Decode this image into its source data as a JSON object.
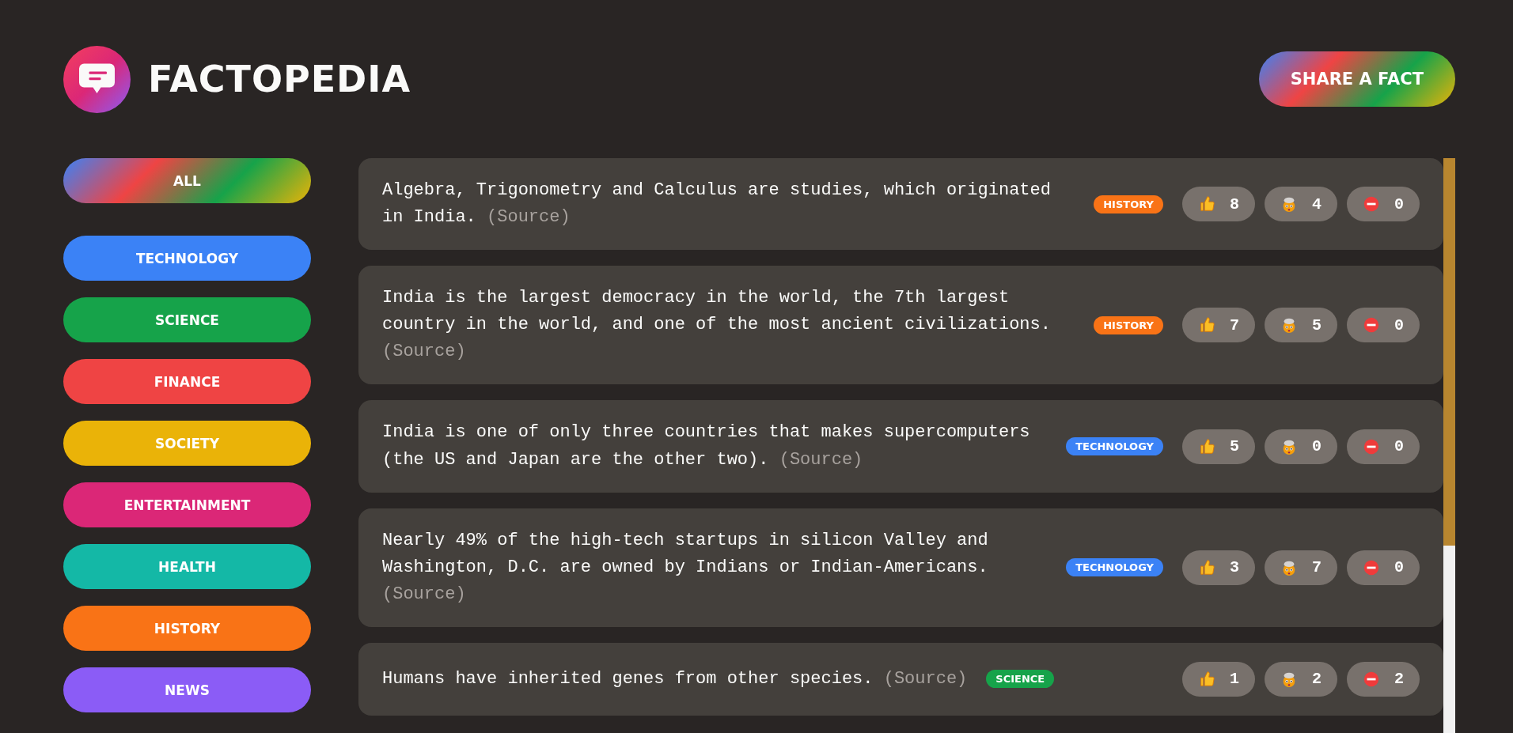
{
  "header": {
    "title": "FACTOPEDIA",
    "share_button": "SHARE A FACT"
  },
  "categories": [
    {
      "label": "ALL",
      "kind": "all"
    },
    {
      "label": "TECHNOLOGY",
      "kind": "category",
      "color": "#3b82f6"
    },
    {
      "label": "SCIENCE",
      "kind": "category",
      "color": "#16a34a"
    },
    {
      "label": "FINANCE",
      "kind": "category",
      "color": "#ef4444"
    },
    {
      "label": "SOCIETY",
      "kind": "category",
      "color": "#eab308"
    },
    {
      "label": "ENTERTAINMENT",
      "kind": "category",
      "color": "#db2777"
    },
    {
      "label": "HEALTH",
      "kind": "category",
      "color": "#14b8a6"
    },
    {
      "label": "HISTORY",
      "kind": "category",
      "color": "#f97316"
    },
    {
      "label": "NEWS",
      "kind": "category",
      "color": "#8b5cf6"
    }
  ],
  "facts": [
    {
      "text": "Algebra, Trigonometry and Calculus are studies, which originated in India.",
      "source": "(Source)",
      "tag": {
        "label": "HISTORY",
        "color": "#f97316"
      },
      "votes": {
        "interesting": "8",
        "mindblowing": "4",
        "false": "0"
      }
    },
    {
      "text": "India is the largest democracy in the world, the 7th largest country in the world, and one of the most ancient civilizations.",
      "source": "(Source)",
      "tag": {
        "label": "HISTORY",
        "color": "#f97316"
      },
      "votes": {
        "interesting": "7",
        "mindblowing": "5",
        "false": "0"
      }
    },
    {
      "text": "India is one of only three countries that makes supercomputers (the US and Japan are the other two).",
      "source": "(Source)",
      "tag": {
        "label": "TECHNOLOGY",
        "color": "#3b82f6"
      },
      "votes": {
        "interesting": "5",
        "mindblowing": "0",
        "false": "0"
      }
    },
    {
      "text": "Nearly 49% of the high-tech startups in silicon Valley and Washington, D.C. are owned by Indians or Indian-Americans.",
      "source": "(Source)",
      "tag": {
        "label": "TECHNOLOGY",
        "color": "#3b82f6"
      },
      "votes": {
        "interesting": "3",
        "mindblowing": "7",
        "false": "0"
      }
    },
    {
      "text": "Humans have inherited genes from other species.",
      "source": "(Source)",
      "tag": {
        "label": "SCIENCE",
        "color": "#16a34a"
      },
      "votes": {
        "interesting": "1",
        "mindblowing": "2",
        "false": "2"
      }
    }
  ]
}
